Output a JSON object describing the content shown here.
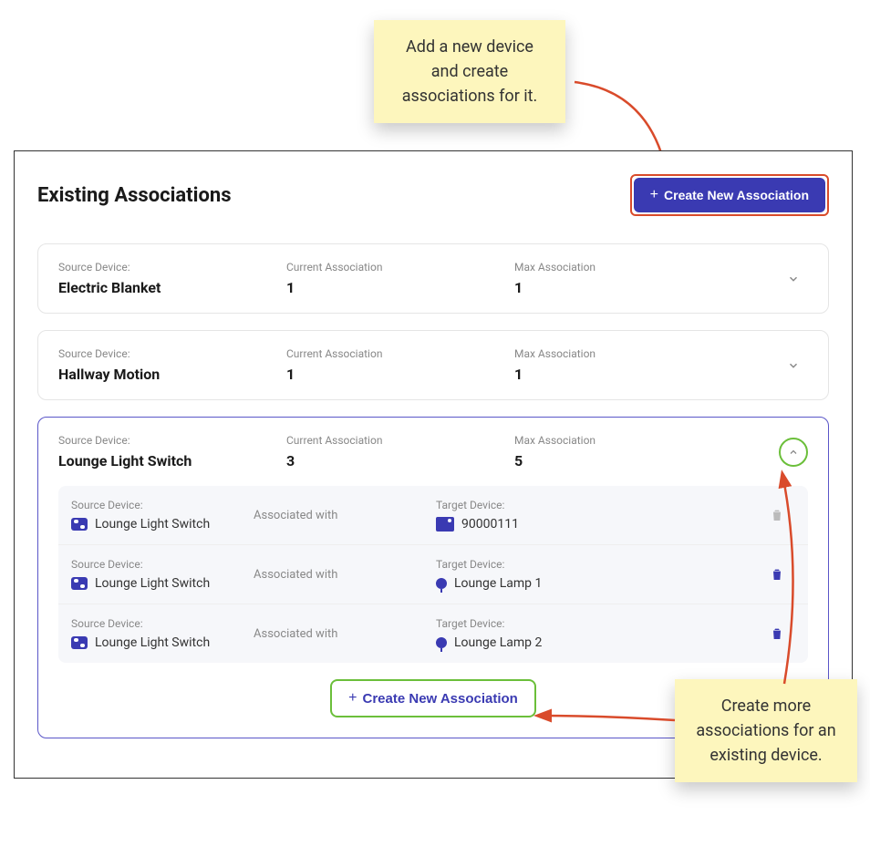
{
  "page": {
    "title": "Existing Associations",
    "create_top_label": "Create New Association",
    "create_bottom_label": "Create New Association"
  },
  "labels": {
    "source_device": "Source Device:",
    "current_assoc": "Current Association",
    "max_assoc": "Max Association",
    "associated_with": "Associated with",
    "target_device": "Target Device:"
  },
  "cards": [
    {
      "source": "Electric Blanket",
      "current": "1",
      "max": "1",
      "expanded": false
    },
    {
      "source": "Hallway Motion",
      "current": "1",
      "max": "1",
      "expanded": false
    },
    {
      "source": "Lounge Light Switch",
      "current": "3",
      "max": "5",
      "expanded": true,
      "rows": [
        {
          "source": "Lounge Light Switch",
          "target": "90000111",
          "target_icon": "hub"
        },
        {
          "source": "Lounge Light Switch",
          "target": "Lounge Lamp 1",
          "target_icon": "bulb"
        },
        {
          "source": "Lounge Light Switch",
          "target": "Lounge Lamp 2",
          "target_icon": "bulb"
        }
      ]
    }
  ],
  "annotations": {
    "top_note": "Add a new device and create associations for it.",
    "bottom_note": "Create more associations for an existing device."
  }
}
